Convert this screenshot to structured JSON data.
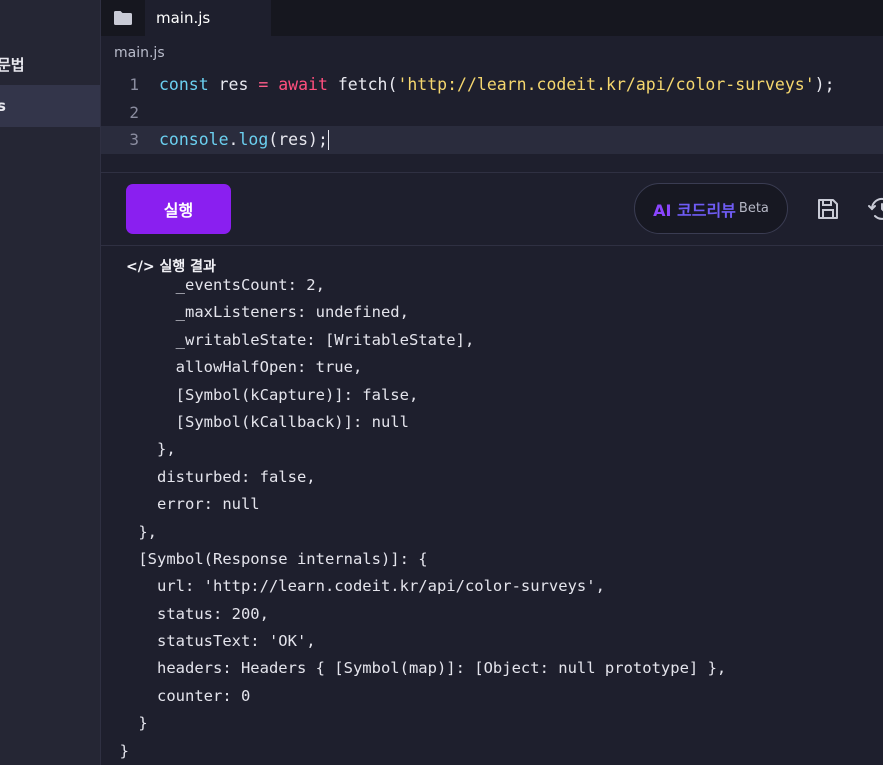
{
  "sidebar": {
    "items": [
      {
        "label": "문법"
      },
      {
        "label": "s"
      }
    ]
  },
  "tabs": [
    {
      "label": "main.js"
    }
  ],
  "editor": {
    "file_label": "main.js",
    "lines": [
      {
        "num": "1"
      },
      {
        "num": "2"
      },
      {
        "num": "3"
      }
    ],
    "line1": {
      "kw": "const",
      "var": " res ",
      "op": "=",
      "sp": " ",
      "await": "await",
      "fn": " fetch(",
      "str": "'http://learn.codeit.kr/api/color-surveys'",
      "end": ");"
    },
    "line3": {
      "obj": "console",
      "dot": ".",
      "method": "log",
      "rest": "(res);"
    }
  },
  "toolbar": {
    "run_label": "실행",
    "ai_label_ai": "AI",
    "ai_label_review": " 코드리뷰",
    "ai_beta": "Beta"
  },
  "result": {
    "title": "</> 실행 결과",
    "lines": [
      "        _eventsCount: 2,",
      "        _maxListeners: undefined,",
      "        _writableState: [WritableState],",
      "        allowHalfOpen: true,",
      "        [Symbol(kCapture)]: false,",
      "        [Symbol(kCallback)]: null",
      "      },",
      "      disturbed: false,",
      "      error: null",
      "    },",
      "    [Symbol(Response internals)]: {",
      "      url: 'http://learn.codeit.kr/api/color-surveys',",
      "      status: 200,",
      "      statusText: 'OK',",
      "      headers: Headers { [Symbol(map)]: [Object: null prototype] },",
      "      counter: 0",
      "    }",
      "  }"
    ]
  },
  "colors": {
    "accent": "#8a1ff0",
    "background": "#1e1f2d",
    "keyword": "#6bd0f0",
    "string": "#f5d76e",
    "await": "#ff4f7e"
  }
}
